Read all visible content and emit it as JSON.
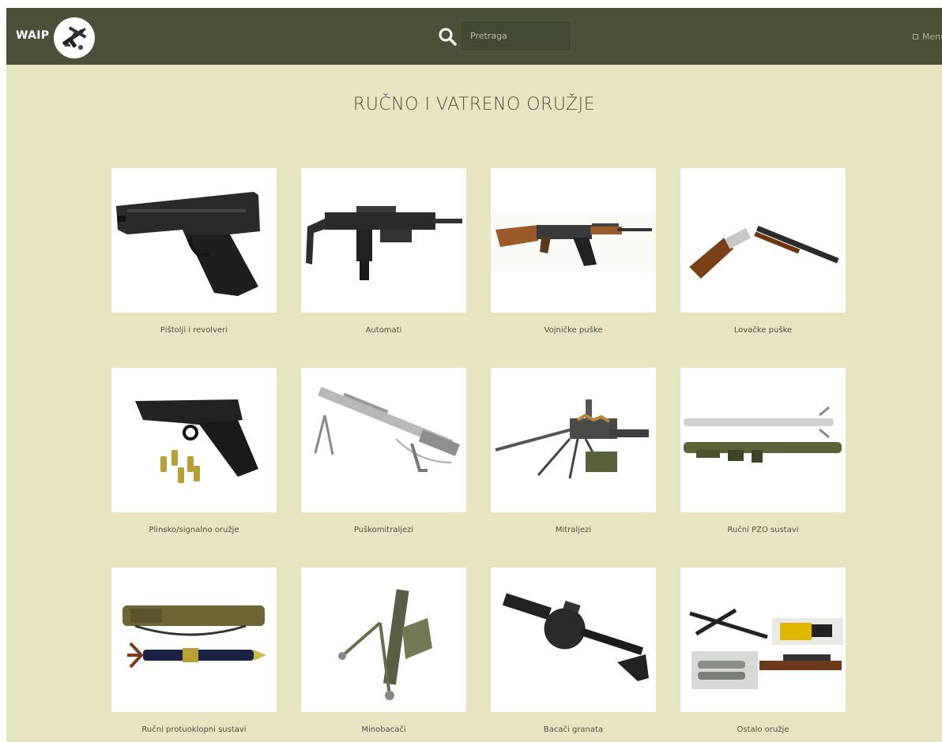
{
  "header": {
    "brand": "WAIP",
    "search_placeholder": "Pretraga",
    "menu_label": "Menu"
  },
  "page": {
    "title": "RUČNO I VATRENO ORUŽJE"
  },
  "categories": [
    {
      "label": "Pištolji i revolveri",
      "icon": "pistol-image"
    },
    {
      "label": "Automati",
      "icon": "submachine-gun-image"
    },
    {
      "label": "Vojničke puške",
      "icon": "assault-rifle-image"
    },
    {
      "label": "Lovačke puške",
      "icon": "hunting-shotgun-image"
    },
    {
      "label": "Plinsko/signalno oružje",
      "icon": "gas-pistol-image"
    },
    {
      "label": "Puškomitraljezi",
      "icon": "light-machine-gun-image"
    },
    {
      "label": "Mitraljezi",
      "icon": "heavy-machine-gun-image"
    },
    {
      "label": "Ručni PZO sustavi",
      "icon": "manpads-image"
    },
    {
      "label": "Ručni protuoklopni sustavi",
      "icon": "anti-tank-launcher-image"
    },
    {
      "label": "Minobacači",
      "icon": "mortar-image"
    },
    {
      "label": "Bacači granata",
      "icon": "grenade-launcher-image"
    },
    {
      "label": "Ostalo oružje",
      "icon": "other-weapons-image"
    }
  ],
  "colors": {
    "header_bg": "#4b5139",
    "page_bg": "#e7e4c2",
    "card_bg": "#ffffff"
  }
}
